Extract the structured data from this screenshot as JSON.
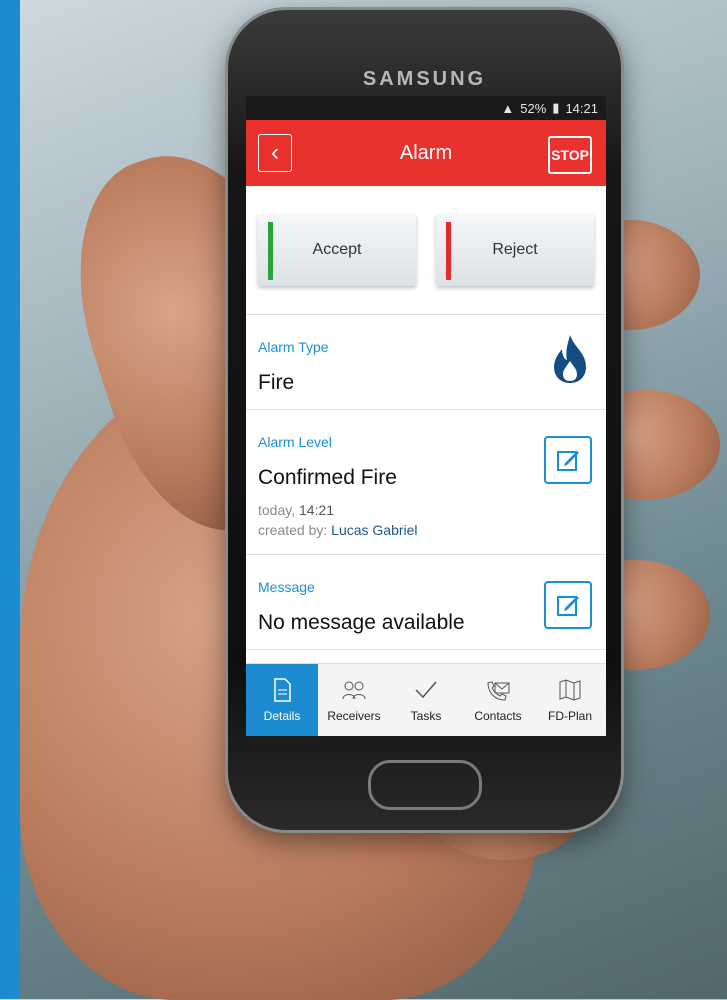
{
  "phone": {
    "brand": "SAMSUNG"
  },
  "status": {
    "battery": "52%",
    "time": "14:21"
  },
  "header": {
    "back_icon": "chevron-left-icon",
    "title": "Alarm",
    "stop_label": "STOP"
  },
  "actions": {
    "accept": "Accept",
    "reject": "Reject",
    "accept_color": "#2aa43a",
    "reject_color": "#e22b2b"
  },
  "alarm_type": {
    "label": "Alarm Type",
    "value": "Fire",
    "icon": "fire-icon"
  },
  "alarm_level": {
    "label": "Alarm Level",
    "value": "Confirmed Fire",
    "date_prefix": "today,",
    "time": "14:21",
    "created_by_label": "created by:",
    "created_by": "Lucas Gabriel"
  },
  "message": {
    "label": "Message",
    "value": "No message available"
  },
  "tabs": [
    {
      "label": "Details",
      "icon": "document-icon",
      "active": true
    },
    {
      "label": "Receivers",
      "icon": "group-icon",
      "active": false
    },
    {
      "label": "Tasks",
      "icon": "checkmark-icon",
      "active": false
    },
    {
      "label": "Contacts",
      "icon": "phone-mail-icon",
      "active": false
    },
    {
      "label": "FD-Plan",
      "icon": "map-icon",
      "active": false
    }
  ],
  "colors": {
    "accent": "#1d8bd0",
    "alarm": "#e9322e"
  }
}
